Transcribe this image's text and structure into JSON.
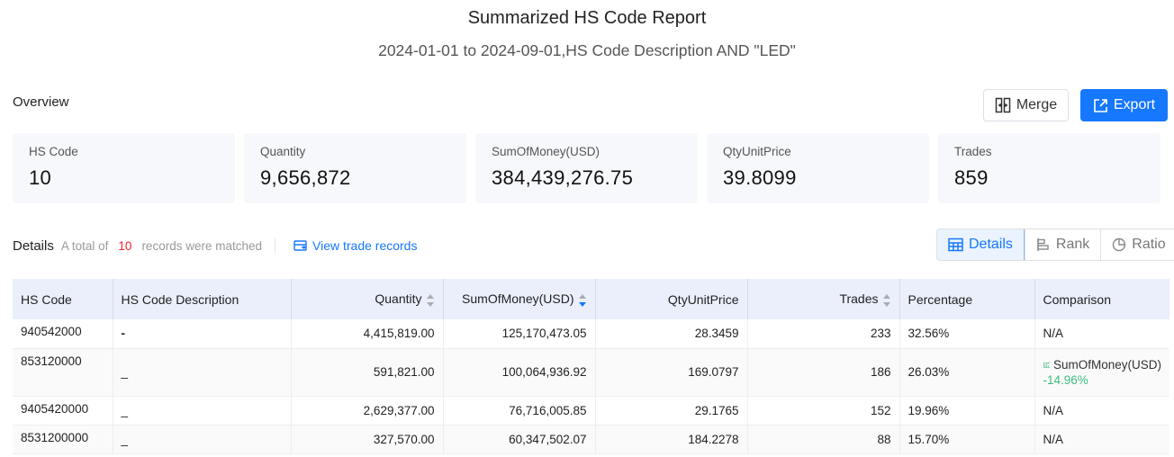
{
  "header": {
    "title": "Summarized HS Code Report",
    "subtitle": "2024-01-01 to 2024-09-01,HS Code Description AND \"LED\""
  },
  "overview": {
    "label": "Overview",
    "merge_label": "Merge",
    "export_label": "Export",
    "cards": [
      {
        "label": "HS Code",
        "value": "10"
      },
      {
        "label": "Quantity",
        "value": "9,656,872"
      },
      {
        "label": "SumOfMoney(USD)",
        "value": "384,439,276.75"
      },
      {
        "label": "QtyUnitPrice",
        "value": "39.8099"
      },
      {
        "label": "Trades",
        "value": "859"
      }
    ]
  },
  "details": {
    "title": "Details",
    "prefix": "A total of",
    "count": "10",
    "suffix": "records were matched",
    "view_link": "View trade records",
    "views": [
      {
        "label": "Details",
        "icon": "table-icon",
        "active": true
      },
      {
        "label": "Rank",
        "icon": "rank-bars-icon",
        "active": false
      },
      {
        "label": "Ratio",
        "icon": "pie-chart-icon",
        "active": false
      }
    ]
  },
  "table": {
    "columns": [
      "HS Code",
      "HS Code Description",
      "Quantity",
      "SumOfMoney(USD)",
      "QtyUnitPrice",
      "Trades",
      "Percentage",
      "Comparison"
    ],
    "rows": [
      {
        "hs_code": "940542000",
        "description": "-",
        "quantity": "4,415,819.00",
        "sum": "125,170,473.05",
        "unit_price": "28.3459",
        "trades": "233",
        "percentage": "32.56%",
        "comparison": "N/A"
      },
      {
        "hs_code": "853120000",
        "description": "_",
        "quantity": "591,821.00",
        "sum": "100,064,936.92",
        "unit_price": "169.0797",
        "trades": "186",
        "percentage": "26.03%",
        "comparison_metric": "SumOfMoney(USD)",
        "comparison_delta": "-14.96%"
      },
      {
        "hs_code": "9405420000",
        "description": "_",
        "quantity": "2,629,377.00",
        "sum": "76,716,005.85",
        "unit_price": "29.1765",
        "trades": "152",
        "percentage": "19.96%",
        "comparison": "N/A"
      },
      {
        "hs_code": "8531200000",
        "description": "_",
        "quantity": "327,570.00",
        "sum": "60,347,502.07",
        "unit_price": "184.2278",
        "trades": "88",
        "percentage": "15.70%",
        "comparison": "N/A"
      }
    ]
  },
  "colors": {
    "accent": "#1677ff",
    "count_red": "#f5222d",
    "delta_green": "#3dbd7d"
  }
}
